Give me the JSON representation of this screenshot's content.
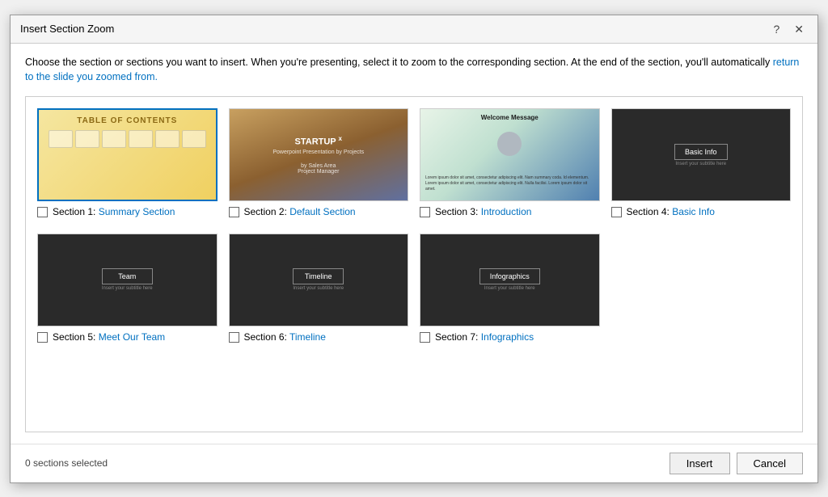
{
  "dialog": {
    "title": "Insert Section Zoom",
    "help_icon": "?",
    "close_icon": "✕",
    "description": "Choose the section or sections you want to insert. When you're presenting, select it to zoom to the corresponding section. At the end of the section, you'll automatically return to the slide you zoomed from.",
    "description_link_text": "return to the slide you zoomed from.",
    "footer": {
      "status": "0 sections selected",
      "insert_label": "Insert",
      "cancel_label": "Cancel"
    }
  },
  "sections": [
    {
      "id": 1,
      "name_prefix": "Section 1: ",
      "name_link": "Summary Section",
      "checked": false,
      "selected": true,
      "thumb_type": "toc",
      "thumb_title": "TABLE OF CONTENTS"
    },
    {
      "id": 2,
      "name_prefix": "Section 2: ",
      "name_link": "Default Section",
      "checked": false,
      "selected": false,
      "thumb_type": "startup",
      "thumb_title": "STARTUP",
      "thumb_sub": "x"
    },
    {
      "id": 3,
      "name_prefix": "Section 3: ",
      "name_link": "Introduction",
      "checked": false,
      "selected": false,
      "thumb_type": "intro",
      "thumb_title": "Welcome Message"
    },
    {
      "id": 4,
      "name_prefix": "Section 4: ",
      "name_link": "Basic Info",
      "checked": false,
      "selected": false,
      "thumb_type": "dark",
      "thumb_label": "Basic Info"
    },
    {
      "id": 5,
      "name_prefix": "Section 5: ",
      "name_link": "Meet Our Team",
      "checked": false,
      "selected": false,
      "thumb_type": "dark",
      "thumb_label": "Team"
    },
    {
      "id": 6,
      "name_prefix": "Section 6: ",
      "name_link": "Timeline",
      "checked": false,
      "selected": false,
      "thumb_type": "dark",
      "thumb_label": "Timeline"
    },
    {
      "id": 7,
      "name_prefix": "Section 7: ",
      "name_link": "Infographics",
      "checked": false,
      "selected": false,
      "thumb_type": "dark",
      "thumb_label": "Infographics"
    }
  ]
}
